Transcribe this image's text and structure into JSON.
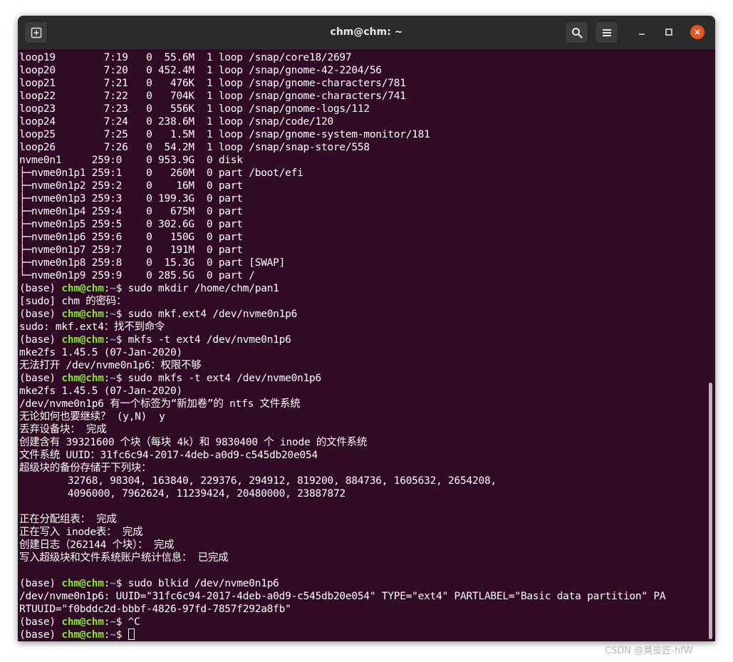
{
  "window": {
    "title": "chm@chm: ~"
  },
  "icons": {
    "new_tab": "new-tab-icon",
    "search": "search-icon",
    "menu": "hamburger-menu-icon",
    "minimize": "minimize-icon",
    "maximize": "maximize-icon",
    "close": "close-icon"
  },
  "colors": {
    "terminal_bg": "#300a24",
    "titlebar_bg": "#2b2b2b",
    "prompt_user": "#8ae234",
    "prompt_path": "#729fcf",
    "close_button": "#e95420"
  },
  "prompt": {
    "env": "(base) ",
    "userhost": "chm@chm",
    "colon": ":",
    "path": "~",
    "dollar": "$ "
  },
  "terminal": {
    "lines": [
      {
        "kind": "out",
        "text": "loop19        7:19   0  55.6M  1 loop /snap/core18/2697"
      },
      {
        "kind": "out",
        "text": "loop20        7:20   0 452.4M  1 loop /snap/gnome-42-2204/56"
      },
      {
        "kind": "out",
        "text": "loop21        7:21   0   476K  1 loop /snap/gnome-characters/781"
      },
      {
        "kind": "out",
        "text": "loop22        7:22   0   704K  1 loop /snap/gnome-characters/741"
      },
      {
        "kind": "out",
        "text": "loop23        7:23   0   556K  1 loop /snap/gnome-logs/112"
      },
      {
        "kind": "out",
        "text": "loop24        7:24   0 238.6M  1 loop /snap/code/120"
      },
      {
        "kind": "out",
        "text": "loop25        7:25   0   1.5M  1 loop /snap/gnome-system-monitor/181"
      },
      {
        "kind": "out",
        "text": "loop26        7:26   0  54.2M  1 loop /snap/snap-store/558"
      },
      {
        "kind": "out",
        "text": "nvme0n1     259:0    0 953.9G  0 disk"
      },
      {
        "kind": "out",
        "text": "├─nvme0n1p1 259:1    0   260M  0 part /boot/efi"
      },
      {
        "kind": "out",
        "text": "├─nvme0n1p2 259:2    0    16M  0 part"
      },
      {
        "kind": "out",
        "text": "├─nvme0n1p3 259:3    0 199.3G  0 part"
      },
      {
        "kind": "out",
        "text": "├─nvme0n1p4 259:4    0   675M  0 part"
      },
      {
        "kind": "out",
        "text": "├─nvme0n1p5 259:5    0 302.6G  0 part"
      },
      {
        "kind": "out",
        "text": "├─nvme0n1p6 259:6    0   150G  0 part"
      },
      {
        "kind": "out",
        "text": "├─nvme0n1p7 259:7    0   191M  0 part"
      },
      {
        "kind": "out",
        "text": "├─nvme0n1p8 259:8    0  15.3G  0 part [SWAP]"
      },
      {
        "kind": "out",
        "text": "└─nvme0n1p9 259:9    0 285.5G  0 part /"
      },
      {
        "kind": "prompt",
        "text": "sudo mkdir /home/chm/pan1"
      },
      {
        "kind": "out",
        "text": "[sudo] chm 的密码："
      },
      {
        "kind": "prompt",
        "text": "sudo mkf.ext4 /dev/nvme0n1p6"
      },
      {
        "kind": "out",
        "text": "sudo: mkf.ext4：找不到命令"
      },
      {
        "kind": "prompt",
        "text": "mkfs -t ext4 /dev/nvme0n1p6"
      },
      {
        "kind": "out",
        "text": "mke2fs 1.45.5 (07-Jan-2020)"
      },
      {
        "kind": "out",
        "text": "无法打开 /dev/nvme0n1p6：权限不够"
      },
      {
        "kind": "prompt",
        "text": "sudo mkfs -t ext4 /dev/nvme0n1p6"
      },
      {
        "kind": "out",
        "text": "mke2fs 1.45.5 (07-Jan-2020)"
      },
      {
        "kind": "out",
        "text": "/dev/nvme0n1p6 有一个标签为“新加卷”的 ntfs 文件系统"
      },
      {
        "kind": "out",
        "text": "无论如何也要继续？ (y,N)  y"
      },
      {
        "kind": "out",
        "text": "丢弃设备块： 完成"
      },
      {
        "kind": "out",
        "text": "创建含有 39321600 个块（每块 4k）和 9830400 个 inode 的文件系统"
      },
      {
        "kind": "out",
        "text": "文件系统 UUID：31fc6c94-2017-4deb-a0d9-c545db20e054"
      },
      {
        "kind": "out",
        "text": "超级块的备份存储于下列块："
      },
      {
        "kind": "out",
        "text": "        32768, 98304, 163840, 229376, 294912, 819200, 884736, 1605632, 2654208,"
      },
      {
        "kind": "out",
        "text": "        4096000, 7962624, 11239424, 20480000, 23887872"
      },
      {
        "kind": "out",
        "text": ""
      },
      {
        "kind": "out",
        "text": "正在分配组表： 完成"
      },
      {
        "kind": "out",
        "text": "正在写入 inode表： 完成"
      },
      {
        "kind": "out",
        "text": "创建日志（262144 个块）： 完成"
      },
      {
        "kind": "out",
        "text": "写入超级块和文件系统账户统计信息： 已完成"
      },
      {
        "kind": "out",
        "text": ""
      },
      {
        "kind": "prompt",
        "text": "sudo blkid /dev/nvme0n1p6"
      },
      {
        "kind": "out",
        "text": "/dev/nvme0n1p6: UUID=\"31fc6c94-2017-4deb-a0d9-c545db20e054\" TYPE=\"ext4\" PARTLABEL=\"Basic data partition\" PA"
      },
      {
        "kind": "out",
        "text": "RTUUID=\"f0bddc2d-bbbf-4826-97fd-7857f292a8fb\""
      },
      {
        "kind": "prompt",
        "text": "^C"
      },
      {
        "kind": "prompt",
        "text": "",
        "cursor": true
      }
    ]
  },
  "watermark": "CSDN @臭皮匠-hfW"
}
